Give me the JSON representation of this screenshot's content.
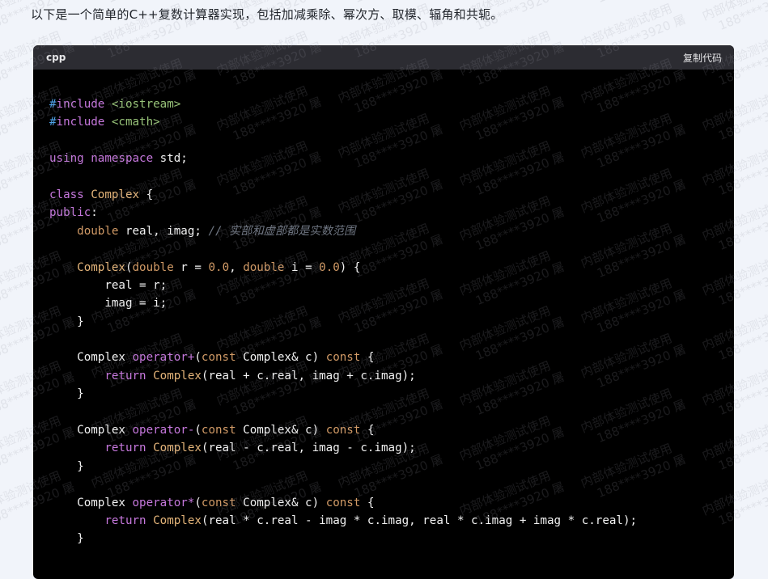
{
  "intro_text": "以下是一个简单的C++复数计算器实现，包括加减乘除、幂次方、取模、辐角和共轭。",
  "code_block": {
    "language": "cpp",
    "copy_label": "复制代码",
    "lines": [
      [
        [
          "t-hash",
          "#"
        ],
        [
          "t-kw",
          "include"
        ],
        [
          "t-plain",
          " "
        ],
        [
          "t-str",
          "<iostream>"
        ]
      ],
      [
        [
          "t-hash",
          "#"
        ],
        [
          "t-kw",
          "include"
        ],
        [
          "t-plain",
          " "
        ],
        [
          "t-str",
          "<cmath>"
        ]
      ],
      [],
      [
        [
          "t-kw",
          "using"
        ],
        [
          "t-plain",
          " "
        ],
        [
          "t-kw",
          "namespace"
        ],
        [
          "t-plain",
          " std;"
        ]
      ],
      [],
      [
        [
          "t-kw",
          "class"
        ],
        [
          "t-plain",
          " "
        ],
        [
          "t-cls",
          "Complex"
        ],
        [
          "t-plain",
          " {"
        ]
      ],
      [
        [
          "t-kw",
          "public"
        ],
        [
          "t-plain",
          ":"
        ]
      ],
      [
        [
          "t-plain",
          "    "
        ],
        [
          "t-type",
          "double"
        ],
        [
          "t-plain",
          " real, imag; "
        ],
        [
          "t-cmt",
          "// 实部和虚部都是实数范围"
        ]
      ],
      [],
      [
        [
          "t-plain",
          "    "
        ],
        [
          "t-fn",
          "Complex"
        ],
        [
          "t-plain",
          "("
        ],
        [
          "t-type",
          "double"
        ],
        [
          "t-plain",
          " r = "
        ],
        [
          "t-num",
          "0.0"
        ],
        [
          "t-plain",
          ", "
        ],
        [
          "t-type",
          "double"
        ],
        [
          "t-plain",
          " i = "
        ],
        [
          "t-num",
          "0.0"
        ],
        [
          "t-plain",
          ") {"
        ]
      ],
      [
        [
          "t-plain",
          "        real = r;"
        ]
      ],
      [
        [
          "t-plain",
          "        imag = i;"
        ]
      ],
      [
        [
          "t-plain",
          "    }"
        ]
      ],
      [],
      [
        [
          "t-plain",
          "    Complex "
        ],
        [
          "t-kw",
          "operator+"
        ],
        [
          "t-plain",
          "("
        ],
        [
          "t-type",
          "const"
        ],
        [
          "t-plain",
          " Complex& c) "
        ],
        [
          "t-type",
          "const"
        ],
        [
          "t-plain",
          " {"
        ]
      ],
      [
        [
          "t-plain",
          "        "
        ],
        [
          "t-kw",
          "return"
        ],
        [
          "t-plain",
          " "
        ],
        [
          "t-fn",
          "Complex"
        ],
        [
          "t-plain",
          "(real + c.real, imag + c.imag);"
        ]
      ],
      [
        [
          "t-plain",
          "    }"
        ]
      ],
      [],
      [
        [
          "t-plain",
          "    Complex "
        ],
        [
          "t-kw",
          "operator-"
        ],
        [
          "t-plain",
          "("
        ],
        [
          "t-type",
          "const"
        ],
        [
          "t-plain",
          " Complex& c) "
        ],
        [
          "t-type",
          "const"
        ],
        [
          "t-plain",
          " {"
        ]
      ],
      [
        [
          "t-plain",
          "        "
        ],
        [
          "t-kw",
          "return"
        ],
        [
          "t-plain",
          " "
        ],
        [
          "t-fn",
          "Complex"
        ],
        [
          "t-plain",
          "(real - c.real, imag - c.imag);"
        ]
      ],
      [
        [
          "t-plain",
          "    }"
        ]
      ],
      [],
      [
        [
          "t-plain",
          "    Complex "
        ],
        [
          "t-kw",
          "operator*"
        ],
        [
          "t-plain",
          "("
        ],
        [
          "t-type",
          "const"
        ],
        [
          "t-plain",
          " Complex& c) "
        ],
        [
          "t-type",
          "const"
        ],
        [
          "t-plain",
          " {"
        ]
      ],
      [
        [
          "t-plain",
          "        "
        ],
        [
          "t-kw",
          "return"
        ],
        [
          "t-plain",
          " "
        ],
        [
          "t-fn",
          "Complex"
        ],
        [
          "t-plain",
          "(real * c.real - imag * c.imag, real * c.imag + imag * c.real);"
        ]
      ],
      [
        [
          "t-plain",
          "    }"
        ]
      ]
    ]
  },
  "watermark": {
    "line1": "内部体验测试使用",
    "line2": "188****3920 屠"
  },
  "colors": {
    "page_bg": "#f1f4fa",
    "code_bg": "#000000",
    "header_bg": "#2c2c32",
    "keyword": "#c678dd",
    "type": "#d19a66",
    "string": "#98c379",
    "preprocessor_hash": "#4fa3e8",
    "comment": "#6f7682"
  }
}
